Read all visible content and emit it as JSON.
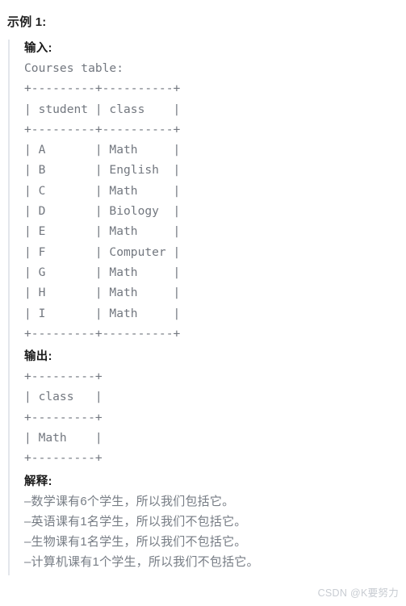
{
  "page": {
    "example_title": "示例 1:"
  },
  "input_section": {
    "label": "输入:",
    "caption": "Courses table:",
    "ascii_table": "+---------+----------+\n| student | class    |\n+---------+----------+\n| A       | Math     |\n| B       | English  |\n| C       | Math     |\n| D       | Biology  |\n| E       | Math     |\n| F       | Computer |\n| G       | Math     |\n| H       | Math     |\n| I       | Math     |\n+---------+----------+"
  },
  "output_section": {
    "label": "输出:",
    "ascii_table": "+---------+\n| class   |\n+---------+\n| Math    |\n+---------+"
  },
  "explanation_section": {
    "label": "解释:",
    "lines": [
      "–数学课有6个学生，所以我们包括它。",
      "–英语课有1名学生，所以我们不包括它。",
      "–生物课有1名学生，所以我们不包括它。",
      "–计算机课有1个学生，所以我们不包括它。"
    ]
  },
  "watermark": {
    "text": "CSDN @K要努力"
  },
  "table_data": {
    "type": "table",
    "input_table_name": "Courses",
    "input_columns": [
      "student",
      "class"
    ],
    "input_rows": [
      [
        "A",
        "Math"
      ],
      [
        "B",
        "English"
      ],
      [
        "C",
        "Math"
      ],
      [
        "D",
        "Biology"
      ],
      [
        "E",
        "Math"
      ],
      [
        "F",
        "Computer"
      ],
      [
        "G",
        "Math"
      ],
      [
        "H",
        "Math"
      ],
      [
        "I",
        "Math"
      ]
    ],
    "output_columns": [
      "class"
    ],
    "output_rows": [
      [
        "Math"
      ]
    ],
    "class_counts": {
      "Math": 6,
      "English": 1,
      "Biology": 1,
      "Computer": 1
    }
  }
}
